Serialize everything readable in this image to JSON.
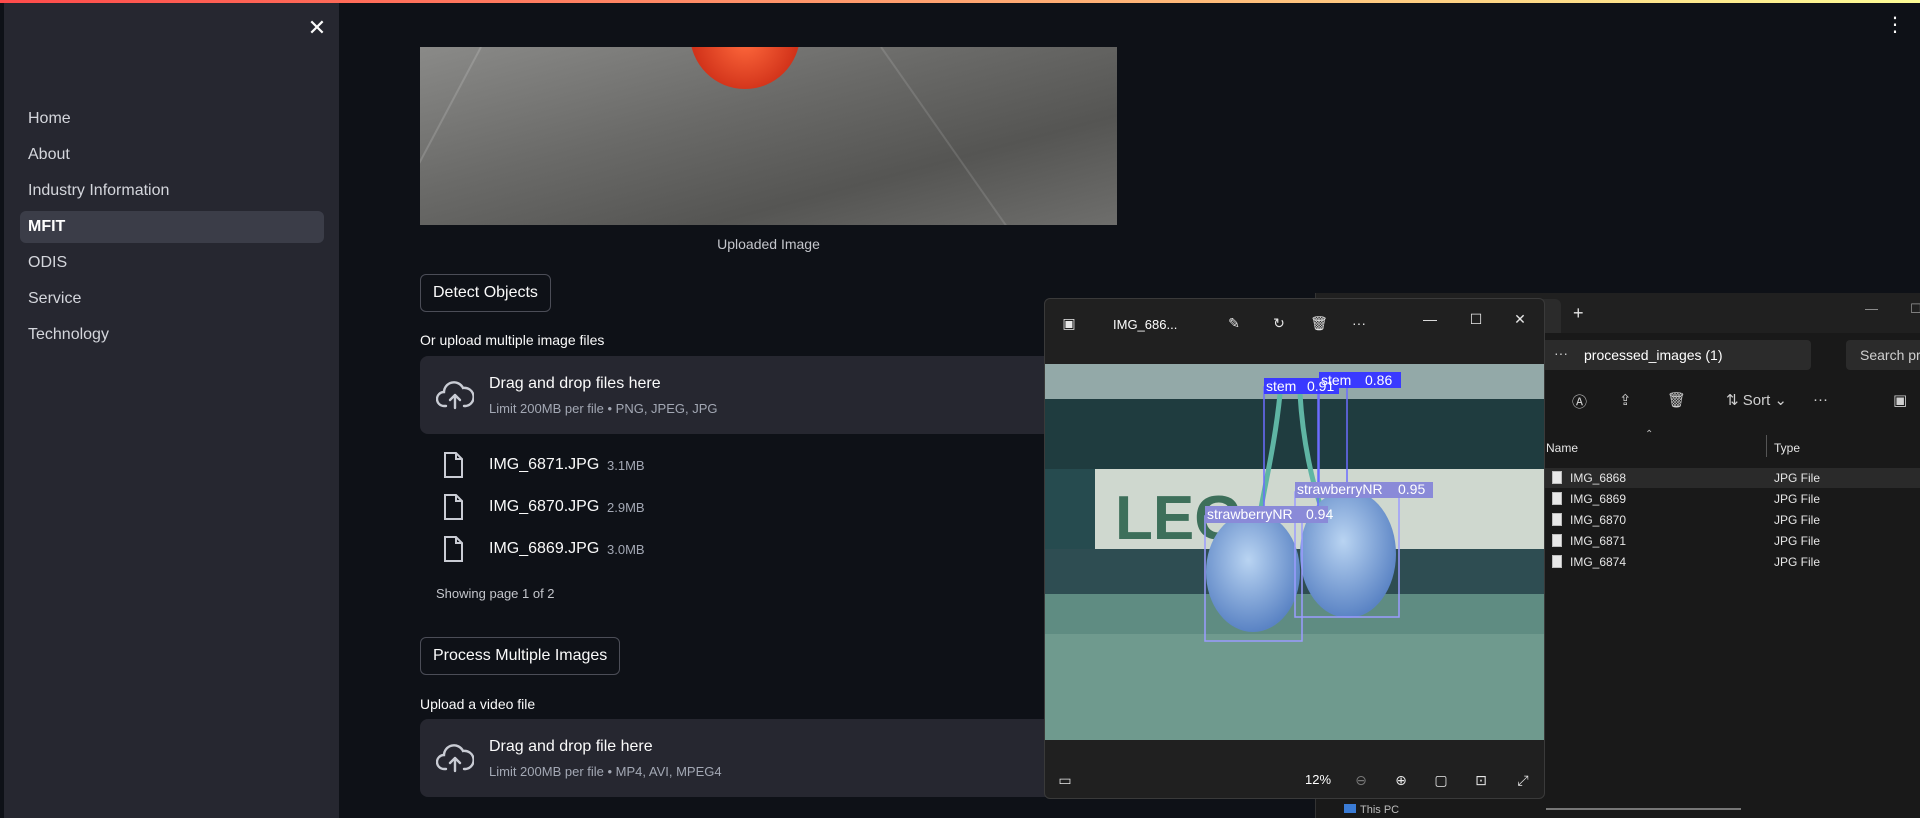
{
  "sidebar": {
    "close_icon": "close-icon",
    "items": [
      {
        "label": "Home",
        "active": false
      },
      {
        "label": "About",
        "active": false
      },
      {
        "label": "Industry Information",
        "active": false
      },
      {
        "label": "MFIT",
        "active": true
      },
      {
        "label": "ODIS",
        "active": false
      },
      {
        "label": "Service",
        "active": false
      },
      {
        "label": "Technology",
        "active": false
      }
    ]
  },
  "main": {
    "image_caption": "Uploaded Image",
    "detect_button": "Detect Objects",
    "multi_label": "Or upload multiple image files",
    "multi_drop": {
      "title": "Drag and drop files here",
      "subtitle": "Limit 200MB per file • PNG, JPEG, JPG"
    },
    "files": [
      {
        "name": "IMG_6871.JPG",
        "size": "3.1MB"
      },
      {
        "name": "IMG_6870.JPG",
        "size": "2.9MB"
      },
      {
        "name": "IMG_6869.JPG",
        "size": "3.0MB"
      }
    ],
    "pager": "Showing page 1 of 2",
    "process_button": "Process Multiple Images",
    "video_label": "Upload a video file",
    "video_drop": {
      "title": "Drag and drop file here",
      "subtitle": "Limit 200MB per file • MP4, AVI, MPEG4"
    }
  },
  "photos_viewer": {
    "title": "IMG_686...",
    "zoom": "12%",
    "detections": [
      {
        "label": "stem",
        "score": "0.91"
      },
      {
        "label": "stem",
        "score": "0.86"
      },
      {
        "label": "strawberryNR",
        "score": "0.95"
      },
      {
        "label": "strawberryNR",
        "score": "0.94"
      }
    ],
    "banner_text": "LEG"
  },
  "explorer": {
    "address": "processed_images (1)",
    "search_placeholder": "Search pr",
    "sort_label": "Sort",
    "columns": {
      "name": "Name",
      "type": "Type"
    },
    "rows": [
      {
        "name": "IMG_6868",
        "type": "JPG File",
        "selected": true
      },
      {
        "name": "IMG_6869",
        "type": "JPG File",
        "selected": false
      },
      {
        "name": "IMG_6870",
        "type": "JPG File",
        "selected": false
      },
      {
        "name": "IMG_6871",
        "type": "JPG File",
        "selected": false
      },
      {
        "name": "IMG_6874",
        "type": "JPG File",
        "selected": false
      }
    ],
    "this_pc": "This PC"
  },
  "colors": {
    "app_bg": "#0e1117",
    "sidebar_bg": "#262730",
    "accent_red": "#ff4b4b",
    "detection_box": "#6c6cff"
  }
}
